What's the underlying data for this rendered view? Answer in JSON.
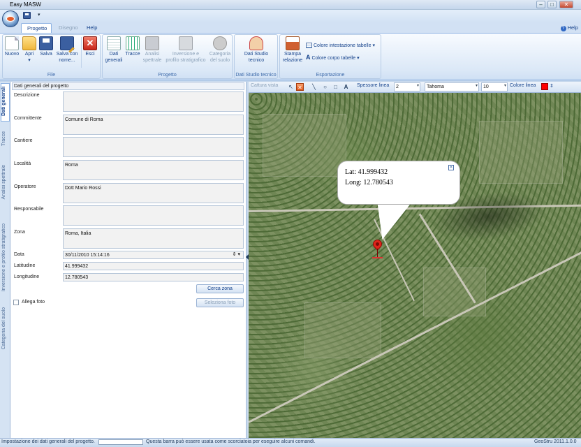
{
  "window": {
    "title": "Easy MASW"
  },
  "tabs": {
    "progetto": "Progetto",
    "disegno": "Disegno",
    "help": "Help"
  },
  "help_link": "Help",
  "ribbon": {
    "file": {
      "label": "File",
      "buttons": {
        "nuovo": "Nuovo",
        "apri": "Apri",
        "apri_dd": "▾",
        "salva": "Salva",
        "salva_con_nome_1": "Salva con",
        "salva_con_nome_2": "nome...",
        "esci": "Esci"
      }
    },
    "progetto": {
      "label": "Progetto",
      "buttons": {
        "dati_1": "Dati",
        "dati_2": "generali",
        "tracce": "Tracce",
        "analisi_1": "Analisi",
        "analisi_2": "spettrale",
        "inversione_1": "Inversione e",
        "inversione_2": "profilo stratigrafico",
        "categoria_1": "Categoria",
        "categoria_2": "del suolo"
      }
    },
    "studio": {
      "label": "Dati Studio tecnico",
      "buttons": {
        "dati_studio_1": "Dati Studio",
        "dati_studio_2": "tecnico"
      }
    },
    "esportazione": {
      "label": "Esportazione",
      "buttons": {
        "stampa_1": "Stampa",
        "stampa_2": "relazione",
        "colore_intestazione": "Colore intestazione tabelle",
        "colore_corpo": "Colore corpo tabelle"
      }
    }
  },
  "vertical_tabs": {
    "dati_generali": "Dati generali",
    "tracce": "Tracce",
    "analisi": "Analisi spettrale",
    "inversione": "Inversione e profilo stratigrafico",
    "categoria": "Categoria del suolo"
  },
  "form": {
    "header": "Dati generali del progetto",
    "descrizione": {
      "label": "Descrizione",
      "value": ""
    },
    "committente": {
      "label": "Committente",
      "value": "Comune di Roma"
    },
    "cantiere": {
      "label": "Cantiere",
      "value": ""
    },
    "localita": {
      "label": "Località",
      "value": "Roma"
    },
    "operatore": {
      "label": "Operatore",
      "value": "Dott Mario Rossi"
    },
    "responsabile": {
      "label": "Responsabile",
      "value": ""
    },
    "zona": {
      "label": "Zona",
      "value": "Roma, Italia"
    },
    "data": {
      "label": "Data",
      "value": "30/11/2010 15:14:16"
    },
    "latitudine": {
      "label": "Latitudine",
      "value": "41.999432"
    },
    "longitudine": {
      "label": "Longitudine",
      "value": "12.780543"
    },
    "cerca_zona": "Cerca zona",
    "seleziona_foto": "Seleziona foto",
    "allega_foto": "Allega foto"
  },
  "map_toolbar": {
    "cattura": "Cattura vista",
    "spessore_label": "Spessore linea",
    "spessore_value": "2",
    "font": "Tahoma",
    "font_size": "10",
    "colore_label": "Colore linea",
    "line_color": "#ff0000"
  },
  "map": {
    "lat_text": "Lat: 41.999432",
    "long_text": "Long: 12.780543"
  },
  "status": {
    "left": "Impostazione dei dati generali del progetto.",
    "hint": "Questa barra può essere usata come scorciatoia per eseguire alcuni comandi.",
    "version": "GeoStru 2011.1.0.0"
  }
}
